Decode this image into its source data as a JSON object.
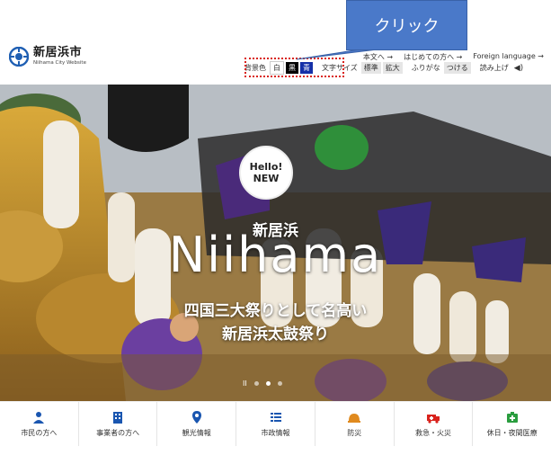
{
  "callout": {
    "label": "クリック"
  },
  "logo": {
    "name": "新居浜市",
    "sub": "Niihama City Website"
  },
  "util_links": [
    {
      "label": "本文へ →"
    },
    {
      "label": "はじめての方へ →"
    },
    {
      "label": "Foreign language →"
    }
  ],
  "accessibility": {
    "bg_label": "背景色",
    "bg_white": "白",
    "bg_black": "黒",
    "bg_blue": "青",
    "font_label": "文字サイズ",
    "font_normal": "標準",
    "font_large": "拡大",
    "furigana_label": "ふりがな",
    "furigana_on": "つける",
    "read_label": "読み上げ",
    "speaker": "◀)"
  },
  "hero": {
    "badge_line1": "Hello!",
    "badge_line2": "NEW",
    "kanji": "新居浜",
    "title": "Niihama",
    "line1": "四国三大祭りとして名高い",
    "line2": "新居浜太鼓祭り",
    "pause": "II",
    "slide_count": 3,
    "active_slide": 2
  },
  "nav": [
    {
      "label": "市民の方へ",
      "icon": "person-icon",
      "color": "#1a56b0"
    },
    {
      "label": "事業者の方へ",
      "icon": "building-icon",
      "color": "#1a56b0"
    },
    {
      "label": "観光情報",
      "icon": "map-pin-icon",
      "color": "#1a56b0"
    },
    {
      "label": "市政情報",
      "icon": "list-icon",
      "color": "#1a56b0"
    },
    {
      "label": "防災",
      "icon": "helmet-icon",
      "color": "#e08a1e"
    },
    {
      "label": "救急・火災",
      "icon": "ambulance-icon",
      "color": "#d9231d"
    },
    {
      "label": "休日・夜間医療",
      "icon": "medical-icon",
      "color": "#2a9d3f"
    }
  ]
}
